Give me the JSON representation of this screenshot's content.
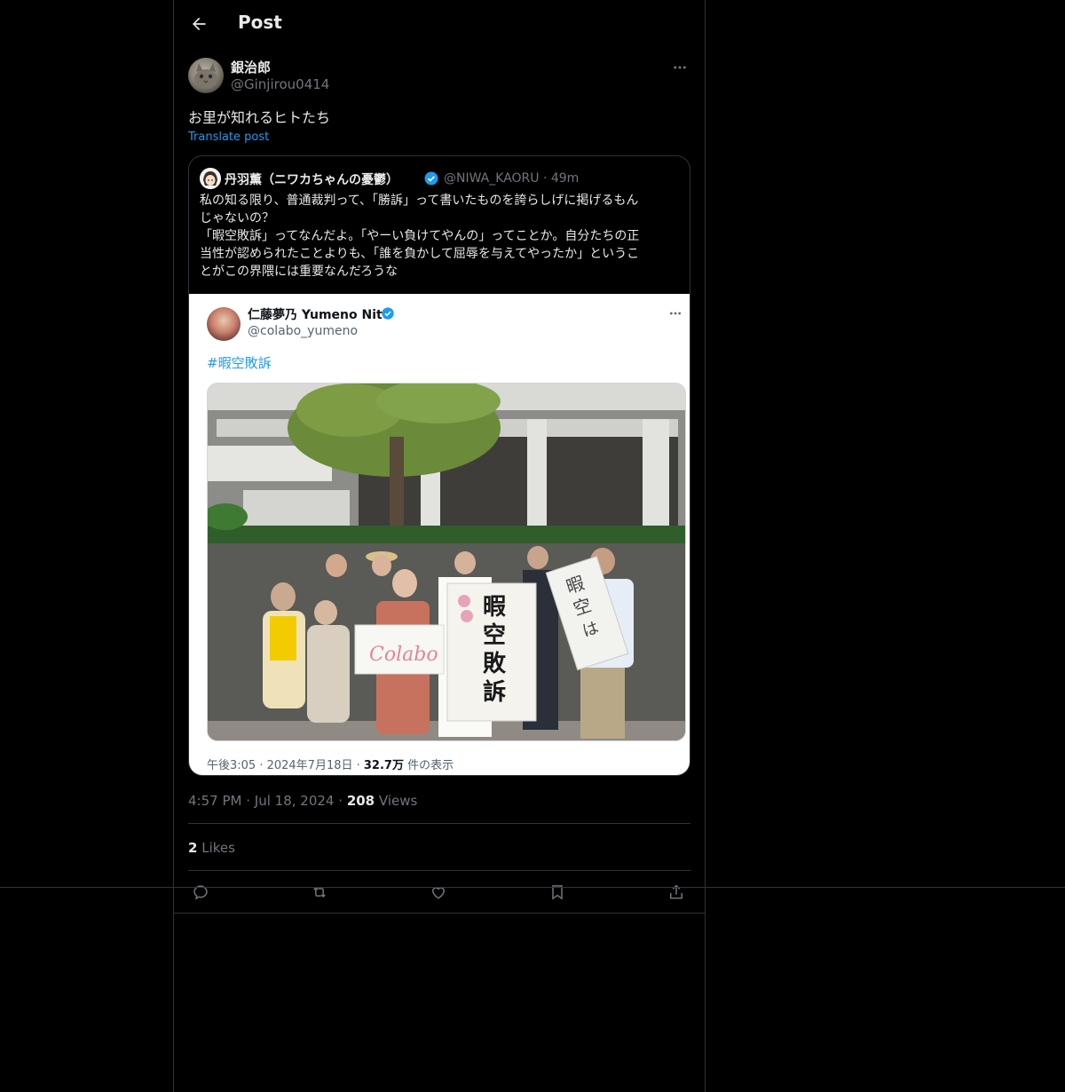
{
  "header": {
    "title": "Post"
  },
  "post": {
    "author_name": "銀治郎",
    "author_handle": "@Ginjirou0414",
    "text": "お里が知れるヒトたち",
    "translate_label": "Translate post"
  },
  "quote": {
    "name": "丹羽薫（ニワカちゃんの憂鬱）",
    "handle": "@NIWA_KAORU",
    "time": "· 49m",
    "text": "私の知る限り、普通裁判って、「勝訴」って書いたものを誇らしげに掲げるもん\nじゃないの？\n「暇空敗訴」ってなんだよ。「やーい負けてやんの」ってことか。自分たちの正\n当性が認められたことよりも、「誰を負かして屈辱を与えてやったか」というこ\nとがこの界隈には重要なんだろうな"
  },
  "screenshot": {
    "name": "仁藤夢乃 Yumeno Nito",
    "handle": "@colabo_yumeno",
    "hashtag": "#暇空敗訴",
    "footer_time": "午後3:05 · 2024年7月18日 · ",
    "footer_count": "32.7万",
    "footer_views": " 件の表示",
    "banner_text": "暇空敗訴",
    "sign_text": "暇空は",
    "colabo_logo": "Colabo"
  },
  "meta": {
    "time": "4:57 PM",
    "date": "Jul 18, 2024",
    "dot": "·",
    "views_count": "208",
    "views_label": "Views"
  },
  "likes": {
    "count": "2",
    "label": "Likes"
  },
  "colors": {
    "background": "#000000",
    "accent": "#1d9bf0",
    "border": "#2f3336",
    "muted": "#71767b",
    "text": "#e7e9ea"
  },
  "icons": [
    "back-arrow-icon",
    "more-icon",
    "verified-icon",
    "reply-icon",
    "repost-icon",
    "like-icon",
    "bookmark-icon",
    "share-icon"
  ]
}
